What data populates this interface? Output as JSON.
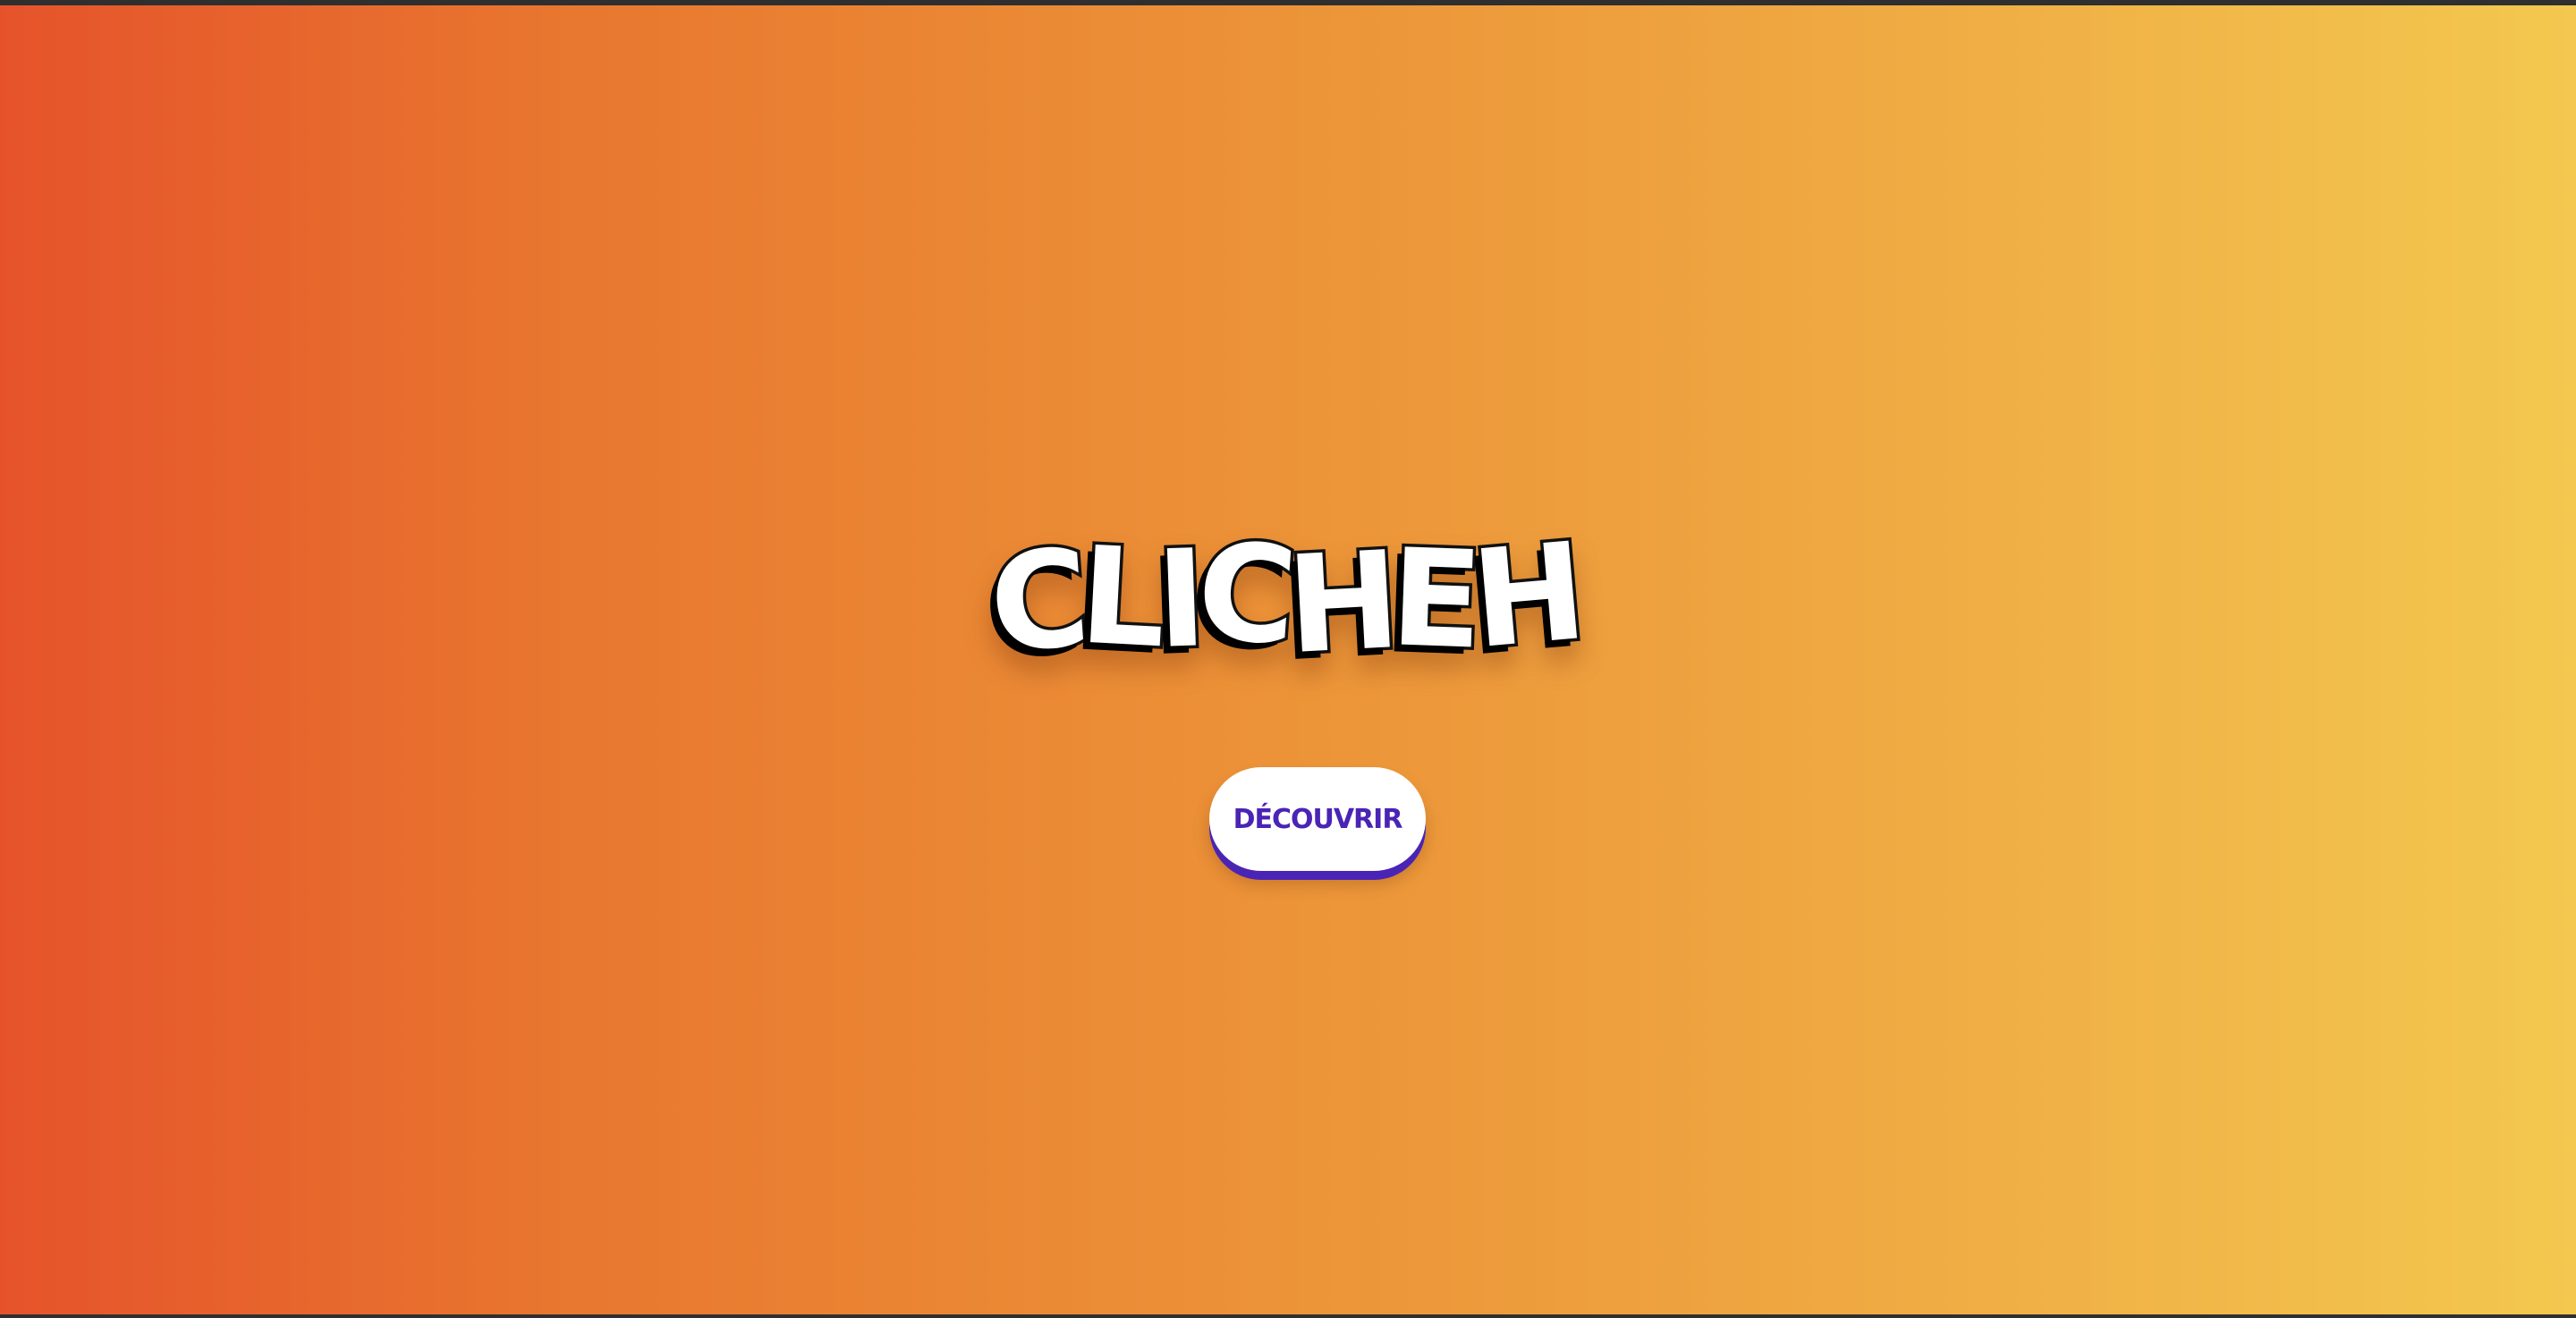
{
  "app": {
    "logo_letters": [
      "C",
      "L",
      "I",
      "C",
      "H",
      "E",
      "H"
    ],
    "colors": {
      "gradient_start": "#e6532b",
      "gradient_end": "#f3c84f",
      "button_text": "#4a24b4",
      "button_background": "#ffffff"
    }
  },
  "hero": {
    "cta_label": "Découvrir"
  }
}
